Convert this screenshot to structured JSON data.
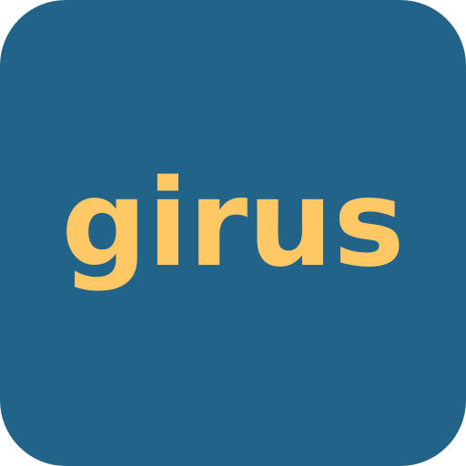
{
  "icon": {
    "wordmark": "girus",
    "background_color": "#226489",
    "text_color": "#FFC864"
  }
}
